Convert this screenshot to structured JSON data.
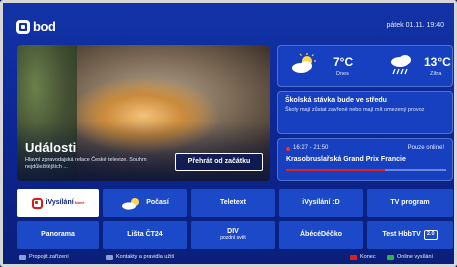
{
  "header": {
    "brand": "bod",
    "datetime": "pátek 01.11. 19:40"
  },
  "hero": {
    "title": "Události",
    "description": "Hlavní zpravodajská relace České televize. Souhrn nejdůležitějších ...",
    "play_label": "Přehrát od začátku"
  },
  "weather": {
    "today": {
      "temp": "7°C",
      "label": "Dnes",
      "icon": "partly-cloudy-icon"
    },
    "tomorrow": {
      "temp": "13°C",
      "label": "Zítra",
      "icon": "rain-cloud-icon"
    }
  },
  "news": {
    "title": "Školská stávka bude ve středu",
    "text": "Školy mají zůstat zavřené nebo mají mít omezený provoz"
  },
  "live": {
    "time": "16:27 - 21:50",
    "status": "Pouze online!",
    "title": "Krasobruslařská Grand Prix Francie",
    "progress": 0.62
  },
  "tiles": {
    "row1": [
      {
        "label": "iVysílání",
        "badge": "Nové"
      },
      {
        "label": "Počasí"
      },
      {
        "label": "Teletext"
      },
      {
        "label": "iVysílání :D"
      },
      {
        "label": "TV program"
      }
    ],
    "row2": [
      {
        "label": "Panorama"
      },
      {
        "label": "Lišta ČT24"
      },
      {
        "label": "DIV",
        "sub": "pozdní svět"
      },
      {
        "label": "ÁbécéDéčko"
      },
      {
        "label": "Test HbbTV",
        "box": "2.0"
      }
    ]
  },
  "legend": {
    "pair": "Propojit zařízení",
    "contacts": "Kontakty a pravidla užití",
    "exit": "Konec",
    "online": "Online vysílání"
  },
  "colors": {
    "background": "#0c2590",
    "tile": "#1c49c8",
    "accent_red": "#e02020",
    "key_green": "#2ab34a"
  }
}
